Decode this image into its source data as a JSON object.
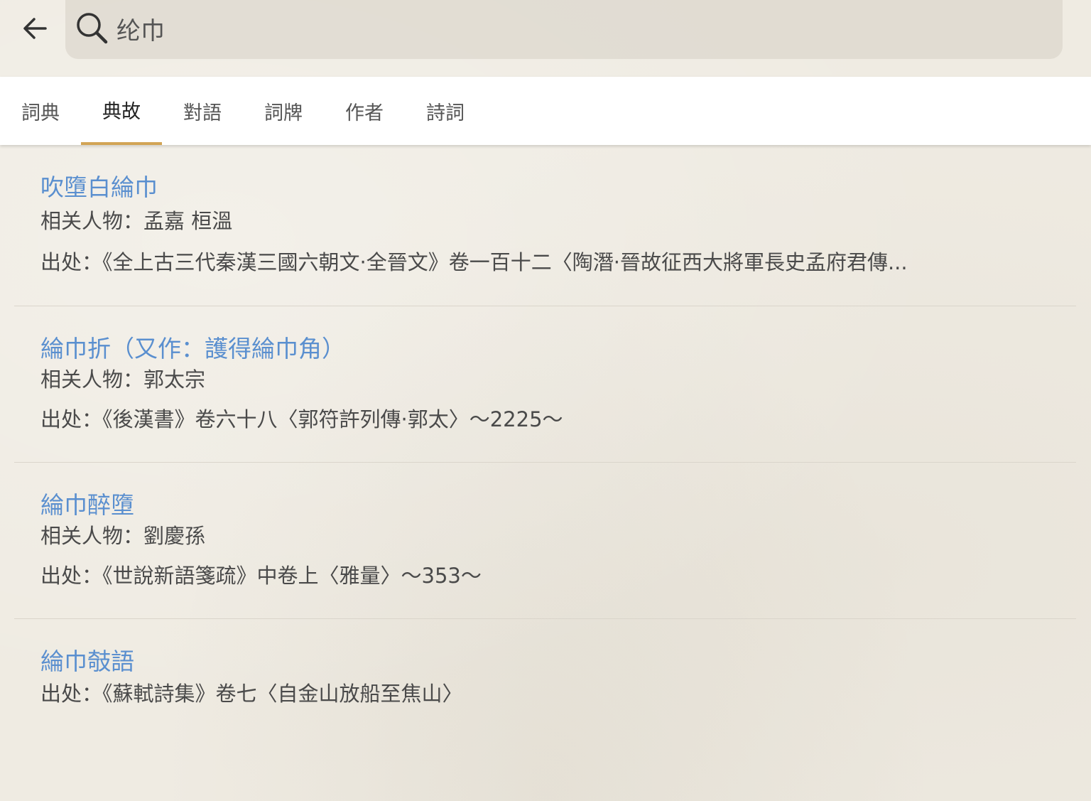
{
  "search": {
    "query": "纶巾"
  },
  "tabs": [
    {
      "label": "詞典",
      "active": false
    },
    {
      "label": "典故",
      "active": true
    },
    {
      "label": "對語",
      "active": false
    },
    {
      "label": "詞牌",
      "active": false
    },
    {
      "label": "作者",
      "active": false
    },
    {
      "label": "詩詞",
      "active": false
    }
  ],
  "labels": {
    "people": "相关人物：",
    "source": "出处："
  },
  "entries": [
    {
      "title": "吹墮白綸巾",
      "people": "孟嘉 桓溫",
      "source": "《全上古三代秦漢三國六朝文·全晉文》卷一百十二〈陶潛·晉故征西大將軍長史孟府君傳..."
    },
    {
      "title": "綸巾折（又作：護得綸巾角）",
      "people": "郭太宗",
      "source": "《後漢書》卷六十八〈郭符許列傳·郭太〉～2225～"
    },
    {
      "title": "綸巾醉墮",
      "people": "劉慶孫",
      "source": "《世說新語箋疏》中卷上〈雅量〉～353～"
    },
    {
      "title": "綸巾攲語",
      "source": "《蘇軾詩集》卷七〈自金山放船至焦山〉"
    }
  ],
  "colors": {
    "background": "#efebe2",
    "title_link": "#5a8fcf",
    "tab_indicator": "#d2a455"
  }
}
